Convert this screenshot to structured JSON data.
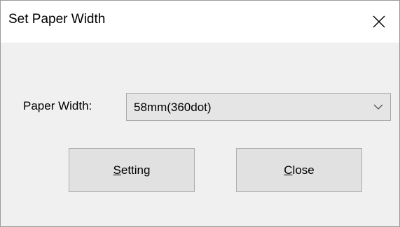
{
  "window": {
    "title": "Set Paper Width",
    "close_icon": "close-icon"
  },
  "form": {
    "paper_width_label": "Paper Width:",
    "paper_width_value": "58mm(360dot)",
    "dropdown_icon": "chevron-down-icon"
  },
  "buttons": {
    "setting": {
      "mnemonic": "S",
      "rest": "etting"
    },
    "close": {
      "mnemonic": "C",
      "rest": "lose"
    }
  },
  "colors": {
    "dialog_background": "#f0f0f0",
    "titlebar_background": "#ffffff",
    "button_background": "#e1e1e1",
    "button_border": "#adadad",
    "combo_background": "#e5e5e5"
  }
}
